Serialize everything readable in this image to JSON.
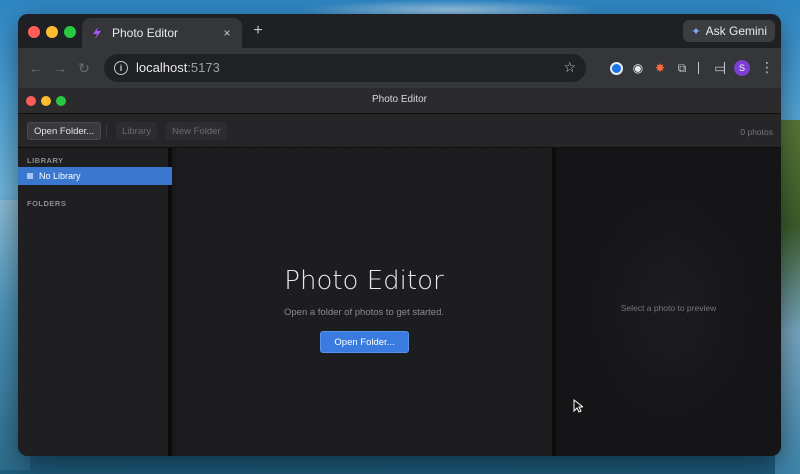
{
  "browser": {
    "tab": {
      "title": "Photo Editor",
      "close": "×"
    },
    "new_tab": "+",
    "gemini": {
      "label": "Ask Gemini",
      "icon": "sparkle-icon"
    },
    "nav": {
      "back": "←",
      "forward": "→",
      "reload": "↻"
    },
    "address": {
      "host": "localhost",
      "port": ":5173"
    },
    "avatar_initial": "S"
  },
  "app": {
    "window_title": "Photo Editor",
    "toolbar": {
      "open_folder": "Open Folder...",
      "library": "Library",
      "new_folder": "New Folder",
      "photo_count": "0 photos"
    },
    "sidebar": {
      "library_heading": "LIBRARY",
      "library_item": "No Library",
      "folders_heading": "FOLDERS"
    },
    "main": {
      "title": "Photo Editor",
      "subtitle": "Open a folder of photos to get started.",
      "button": "Open Folder..."
    },
    "preview": {
      "placeholder": "Select a photo to preview"
    }
  },
  "colors": {
    "accent": "#3a7be0",
    "selection": "#3a78d0",
    "app_bg": "#18191b"
  }
}
